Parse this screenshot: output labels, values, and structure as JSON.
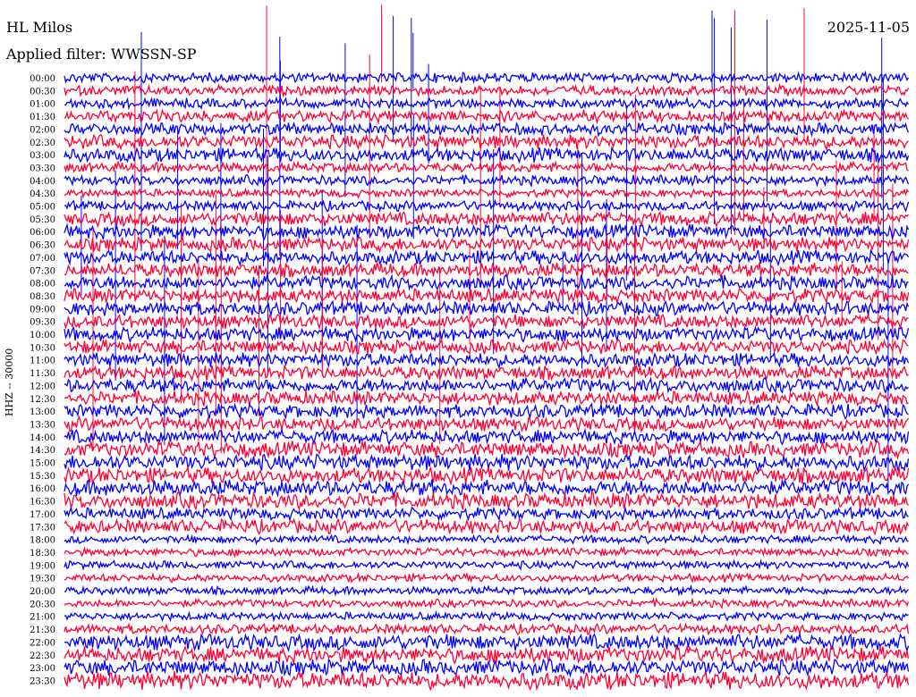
{
  "header": {
    "station": "HL Milos",
    "date": "2025-11-05",
    "filter": "Applied filter: WWSSN-SP"
  },
  "axis": {
    "channel_label": "HHZ -- 30000"
  },
  "colors": {
    "trace_a": "#0000ff",
    "trace_b": "#ff0033",
    "background": "#ffffff"
  },
  "rows": [
    {
      "label": "00:00",
      "amp": 5,
      "color": "trace_a"
    },
    {
      "label": "00:30",
      "amp": 5,
      "color": "trace_b"
    },
    {
      "label": "01:00",
      "amp": 5,
      "color": "trace_a"
    },
    {
      "label": "01:30",
      "amp": 6,
      "color": "trace_b"
    },
    {
      "label": "02:00",
      "amp": 6,
      "color": "trace_a"
    },
    {
      "label": "02:30",
      "amp": 7,
      "color": "trace_b"
    },
    {
      "label": "03:00",
      "amp": 7,
      "color": "trace_a"
    },
    {
      "label": "03:30",
      "amp": 5,
      "color": "trace_b"
    },
    {
      "label": "04:00",
      "amp": 5,
      "color": "trace_a"
    },
    {
      "label": "04:30",
      "amp": 4,
      "color": "trace_b"
    },
    {
      "label": "05:00",
      "amp": 5,
      "color": "trace_a"
    },
    {
      "label": "05:30",
      "amp": 7,
      "color": "trace_b"
    },
    {
      "label": "06:00",
      "amp": 7,
      "color": "trace_a"
    },
    {
      "label": "06:30",
      "amp": 7,
      "color": "trace_b"
    },
    {
      "label": "07:00",
      "amp": 7,
      "color": "trace_a"
    },
    {
      "label": "07:30",
      "amp": 7,
      "color": "trace_b"
    },
    {
      "label": "08:00",
      "amp": 7,
      "color": "trace_a"
    },
    {
      "label": "08:30",
      "amp": 7,
      "color": "trace_b"
    },
    {
      "label": "09:00",
      "amp": 7,
      "color": "trace_a"
    },
    {
      "label": "09:30",
      "amp": 7,
      "color": "trace_b"
    },
    {
      "label": "10:00",
      "amp": 7,
      "color": "trace_a"
    },
    {
      "label": "10:30",
      "amp": 7,
      "color": "trace_b"
    },
    {
      "label": "11:00",
      "amp": 7,
      "color": "trace_a"
    },
    {
      "label": "11:30",
      "amp": 7,
      "color": "trace_b"
    },
    {
      "label": "12:00",
      "amp": 7,
      "color": "trace_a"
    },
    {
      "label": "12:30",
      "amp": 7,
      "color": "trace_b"
    },
    {
      "label": "13:00",
      "amp": 7,
      "color": "trace_a"
    },
    {
      "label": "13:30",
      "amp": 7,
      "color": "trace_b"
    },
    {
      "label": "14:00",
      "amp": 7,
      "color": "trace_a"
    },
    {
      "label": "14:30",
      "amp": 8,
      "color": "trace_b"
    },
    {
      "label": "15:00",
      "amp": 8,
      "color": "trace_a"
    },
    {
      "label": "15:30",
      "amp": 8,
      "color": "trace_b"
    },
    {
      "label": "16:00",
      "amp": 8,
      "color": "trace_a"
    },
    {
      "label": "16:30",
      "amp": 8,
      "color": "trace_b"
    },
    {
      "label": "17:00",
      "amp": 6,
      "color": "trace_a"
    },
    {
      "label": "17:30",
      "amp": 7,
      "color": "trace_b"
    },
    {
      "label": "18:00",
      "amp": 4,
      "color": "trace_a"
    },
    {
      "label": "18:30",
      "amp": 4,
      "color": "trace_b"
    },
    {
      "label": "19:00",
      "amp": 4,
      "color": "trace_a"
    },
    {
      "label": "19:30",
      "amp": 4,
      "color": "trace_b"
    },
    {
      "label": "20:00",
      "amp": 4,
      "color": "trace_a"
    },
    {
      "label": "20:30",
      "amp": 4,
      "color": "trace_b"
    },
    {
      "label": "21:00",
      "amp": 4,
      "color": "trace_a"
    },
    {
      "label": "21:30",
      "amp": 5,
      "color": "trace_b"
    },
    {
      "label": "22:00",
      "amp": 8,
      "color": "trace_a"
    },
    {
      "label": "22:30",
      "amp": 8,
      "color": "trace_b"
    },
    {
      "label": "23:00",
      "amp": 8,
      "color": "trace_a"
    },
    {
      "label": "23:30",
      "amp": 9,
      "color": "trace_b"
    }
  ]
}
